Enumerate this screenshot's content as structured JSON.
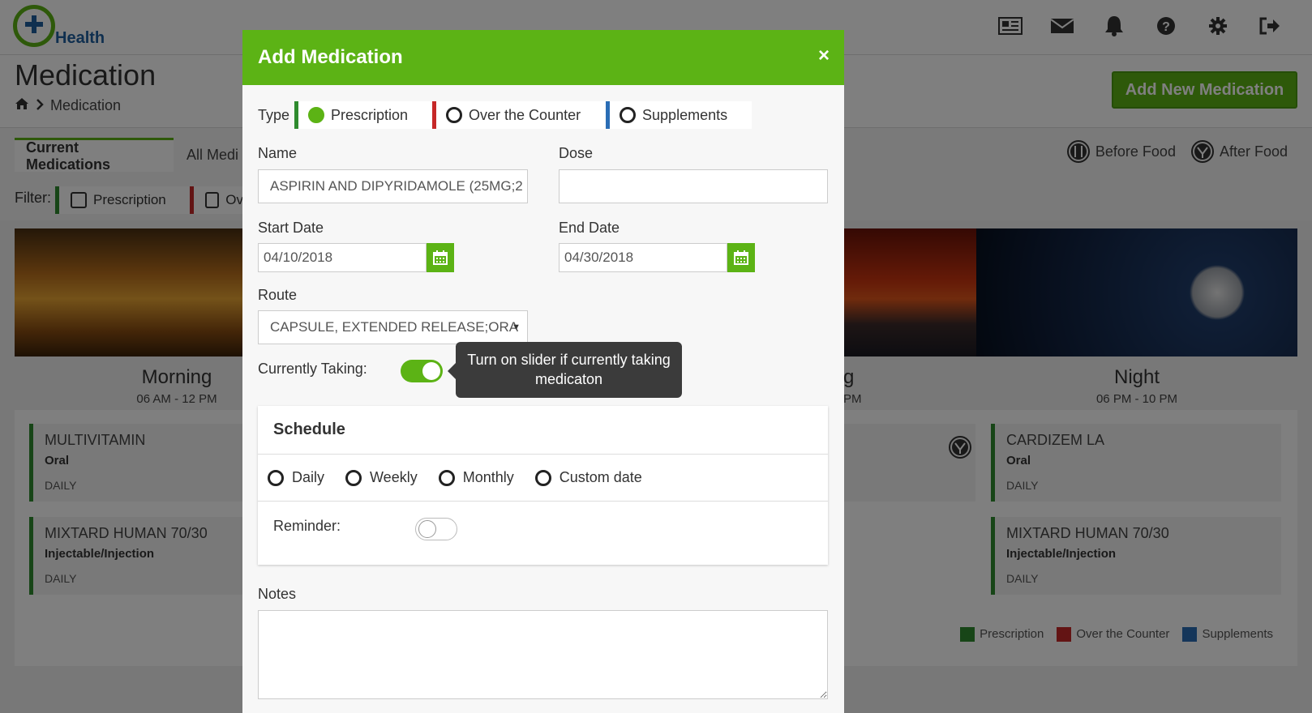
{
  "app": {
    "logo_text": "Health",
    "top_icons": [
      "newspaper-icon",
      "envelope-icon",
      "bell-icon",
      "question-icon",
      "gear-icon",
      "logout-icon"
    ]
  },
  "page": {
    "title": "Medication",
    "breadcrumb": "Medication",
    "add_new_label": "Add New Medication"
  },
  "tabs": {
    "current": "Current Medications",
    "all": "All Medi"
  },
  "food_legend": {
    "before": "Before Food",
    "after": "After Food"
  },
  "filter": {
    "label": "Filter:",
    "prescription": "Prescription",
    "otc": "Ov"
  },
  "periods": {
    "morning": {
      "title": "Morning",
      "time": "06 AM - 12 PM"
    },
    "evening": {
      "title": "g",
      "time": "PM"
    },
    "night": {
      "title": "Night",
      "time": "06 PM - 10 PM"
    }
  },
  "cards": {
    "morning": [
      {
        "name": "MULTIVITAMIN",
        "route": "Oral",
        "freq": "DAILY"
      },
      {
        "name": "MIXTARD HUMAN 70/30",
        "route": "Injectable/Injection",
        "freq": "DAILY"
      }
    ],
    "night": [
      {
        "name": "CARDIZEM LA",
        "route": "Oral",
        "freq": "DAILY"
      },
      {
        "name": "MIXTARD HUMAN 70/30",
        "route": "Injectable/Injection",
        "freq": "DAILY"
      }
    ]
  },
  "legend": {
    "prescription": "Prescription",
    "otc": "Over the Counter",
    "supplements": "Supplements",
    "colors": {
      "prescription": "#2e8b2e",
      "otc": "#c62828",
      "supplements": "#2a6db5"
    }
  },
  "modal": {
    "title": "Add Medication",
    "close": "×",
    "type_label": "Type",
    "types": {
      "prescription": "Prescription",
      "otc": "Over the Counter",
      "supplements": "Supplements"
    },
    "name_label": "Name",
    "name_value": "ASPIRIN AND DIPYRIDAMOLE (25MG;2",
    "dose_label": "Dose",
    "dose_value": "",
    "start_label": "Start Date",
    "start_value": "04/10/2018",
    "end_label": "End Date",
    "end_value": "04/30/2018",
    "route_label": "Route",
    "route_value": "CAPSULE, EXTENDED RELEASE;ORA",
    "taking_label": "Currently Taking:",
    "taking_on": true,
    "tooltip": "Turn on slider if currently taking medicaton",
    "schedule_title": "Schedule",
    "schedule_options": {
      "daily": "Daily",
      "weekly": "Weekly",
      "monthly": "Monthly",
      "custom": "Custom date"
    },
    "reminder_label": "Reminder:",
    "reminder_on": false,
    "notes_label": "Notes",
    "notes_value": ""
  },
  "accent": "#5cb315"
}
